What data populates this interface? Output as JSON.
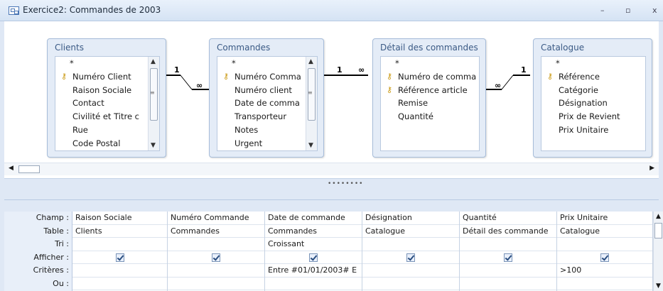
{
  "window": {
    "title": "Exercice2: Commandes de 2003",
    "minimize": "–",
    "restore": "▫",
    "close": "x"
  },
  "tables": [
    {
      "name": "Clients",
      "fields": [
        {
          "label": "*",
          "key": false
        },
        {
          "label": "Numéro Client",
          "key": true
        },
        {
          "label": "Raison Sociale",
          "key": false
        },
        {
          "label": "Contact",
          "key": false
        },
        {
          "label": "Civilité et Titre c",
          "key": false
        },
        {
          "label": "Rue",
          "key": false
        },
        {
          "label": "Code Postal",
          "key": false
        }
      ]
    },
    {
      "name": "Commandes",
      "fields": [
        {
          "label": "*",
          "key": false
        },
        {
          "label": "Numéro Comma",
          "key": true
        },
        {
          "label": "Numéro client",
          "key": false
        },
        {
          "label": "Date de comma",
          "key": false
        },
        {
          "label": "Transporteur",
          "key": false
        },
        {
          "label": "Notes",
          "key": false
        },
        {
          "label": "Urgent",
          "key": false
        }
      ]
    },
    {
      "name": "Détail des commandes",
      "fields": [
        {
          "label": "*",
          "key": false
        },
        {
          "label": "Numéro de comma",
          "key": true
        },
        {
          "label": "Référence article",
          "key": true
        },
        {
          "label": "Remise",
          "key": false
        },
        {
          "label": "Quantité",
          "key": false
        }
      ]
    },
    {
      "name": "Catalogue",
      "fields": [
        {
          "label": "*",
          "key": false
        },
        {
          "label": "Référence",
          "key": true
        },
        {
          "label": "Catégorie",
          "key": false
        },
        {
          "label": "Désignation",
          "key": false
        },
        {
          "label": "Prix de Revient",
          "key": false
        },
        {
          "label": "Prix Unitaire",
          "key": false
        }
      ]
    }
  ],
  "relations": {
    "one": "1",
    "many": "∞"
  },
  "grid": {
    "row_labels": [
      "Champ :",
      "Table :",
      "Tri :",
      "Afficher :",
      "Critères :",
      "Ou :"
    ],
    "columns": [
      {
        "champ": "Raison Sociale",
        "table": "Clients",
        "tri": "",
        "afficher": true,
        "criteres": "",
        "ou": ""
      },
      {
        "champ": "Numéro Commande",
        "table": "Commandes",
        "tri": "",
        "afficher": true,
        "criteres": "",
        "ou": ""
      },
      {
        "champ": "Date de commande",
        "table": "Commandes",
        "tri": "Croissant",
        "afficher": true,
        "criteres": "Entre #01/01/2003# E",
        "ou": ""
      },
      {
        "champ": "Désignation",
        "table": "Catalogue",
        "tri": "",
        "afficher": true,
        "criteres": "",
        "ou": ""
      },
      {
        "champ": "Quantité",
        "table": "Détail des commande",
        "tri": "",
        "afficher": true,
        "criteres": "",
        "ou": ""
      },
      {
        "champ": "Prix Unitaire",
        "table": "Catalogue",
        "tri": "",
        "afficher": true,
        "criteres": ">100",
        "ou": ""
      }
    ]
  },
  "icons": {
    "key": "key-icon",
    "scroll_up": "▲",
    "scroll_down": "▼",
    "scroll_left": "◀",
    "scroll_right": "▶"
  },
  "colors": {
    "titlebar": "#dfe8f5",
    "table_box": "#e4ecf7",
    "key": "#c8960b"
  }
}
